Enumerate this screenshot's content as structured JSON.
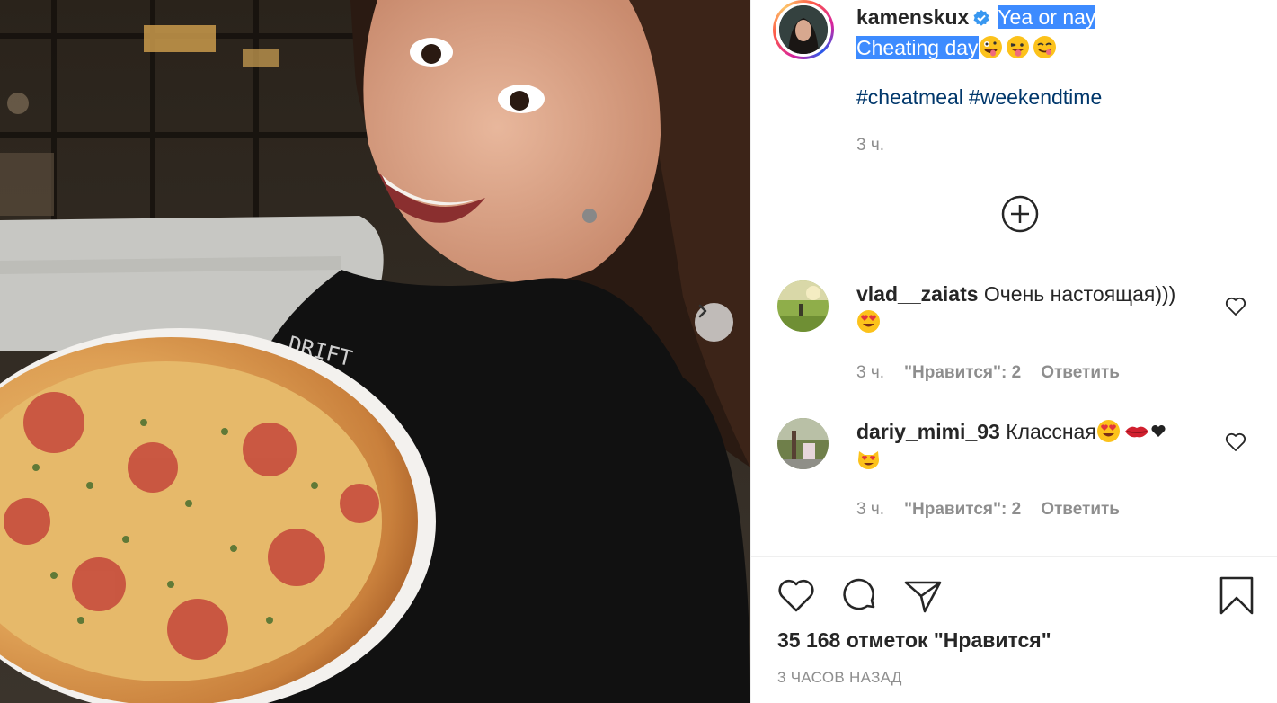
{
  "post": {
    "image_alt": "Selfie with pizza",
    "next_button": "next-slide"
  },
  "author": {
    "username": "kamenskux",
    "caption_line1": "Yea or nay",
    "caption_line2": "Cheating day",
    "hashtags": [
      "#cheatmeal",
      "#weekendtime"
    ],
    "time": "3 ч."
  },
  "comments": [
    {
      "username": "vlad__zaiats",
      "text": "Очень настоящая)))",
      "time": "3 ч.",
      "likes": "\"Нравится\": 2",
      "reply": "Ответить"
    },
    {
      "username": "dariy_mimi_93",
      "text": "Классная",
      "time": "3 ч.",
      "likes": "\"Нравится\": 2",
      "reply": "Ответить"
    }
  ],
  "footer": {
    "likes_count": "35 168 отметок \"Нравится\"",
    "time_ago": "3 ЧАСОВ НАЗАД"
  },
  "colors": {
    "link": "#00376b",
    "highlight": "#3d8bff",
    "muted": "#8e8e8e",
    "verified": "#3897f0"
  }
}
